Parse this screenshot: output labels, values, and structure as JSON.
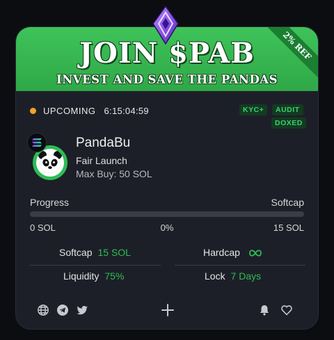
{
  "banner": {
    "title": "JOIN $PAB",
    "subtitle": "INVEST AND SAVE THE PANDAS",
    "ribbon": "2% REF",
    "icon": "gem-icon"
  },
  "status": {
    "label": "UPCOMING",
    "countdown": "6:15:04:59",
    "dot_color": "#f0a623"
  },
  "badges": [
    "KYC+",
    "AUDIT",
    "DOXED"
  ],
  "project": {
    "name": "PandaBu",
    "launch_type": "Fair Launch",
    "max_buy": "Max Buy: 50 SOL",
    "chain_icon": "solana-icon",
    "logo_icon": "panda-icon"
  },
  "progress": {
    "label": "Progress",
    "right_label": "Softcap",
    "min": "0 SOL",
    "percent_text": "0%",
    "percent_value": 0,
    "max": "15 SOL"
  },
  "stats": {
    "softcap_label": "Softcap",
    "softcap_value": "15 SOL",
    "hardcap_label": "Hardcap",
    "hardcap_value_icon": "infinity-icon",
    "liquidity_label": "Liquidity",
    "liquidity_value": "75%",
    "lock_label": "Lock",
    "lock_value": "7 Days"
  },
  "footer": {
    "left_icons": [
      "globe-icon",
      "telegram-icon",
      "twitter-icon"
    ],
    "center_icon": "plus-icon",
    "right_icons": [
      "bell-icon",
      "heart-icon"
    ]
  },
  "colors": {
    "accent": "#2dbd55",
    "card_bg": "#1d1f28",
    "page_bg": "#0c0d11",
    "badge_text": "#36d36a"
  }
}
